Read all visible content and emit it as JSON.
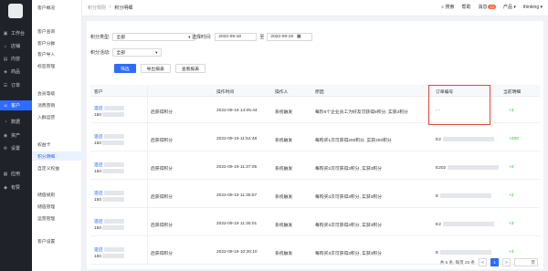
{
  "nav": {
    "items": [
      {
        "label": "工作台",
        "icon": "dashboard-icon"
      },
      {
        "label": "店铺",
        "icon": "store-icon"
      },
      {
        "label": "内容",
        "icon": "content-icon"
      },
      {
        "label": "商品",
        "icon": "goods-icon"
      },
      {
        "label": "订单",
        "icon": "order-icon"
      },
      {
        "label": "客户",
        "icon": "customer-icon"
      },
      {
        "label": "数据",
        "icon": "data-icon"
      },
      {
        "label": "资产",
        "icon": "asset-icon"
      },
      {
        "label": "设置",
        "icon": "settings-icon"
      },
      {
        "label": "应用",
        "icon": "apps-icon"
      },
      {
        "label": "有赞",
        "icon": "youzan-icon"
      }
    ],
    "active_index": 5
  },
  "subnav": {
    "items": [
      "客户概况",
      "客户查询",
      "客户分群",
      "客户导入",
      "标签管理",
      "会员等级",
      "消费营销",
      "入群运营",
      "权益卡",
      "积分明细",
      "自定义权益",
      "储值规则",
      "储值管理",
      "运营管理",
      "客户设置"
    ],
    "active_label": "积分明细"
  },
  "topbar": {
    "breadcrumb": [
      "积分规则",
      "积分明细"
    ],
    "search": "搜索",
    "help": "帮助",
    "message": "消息",
    "message_count": "12",
    "product": "产品",
    "user": "thinking"
  },
  "filters": {
    "type_label": "积分类型:",
    "type_value": "全部",
    "time_label": "选择时间:",
    "date_from": "2022-09-18",
    "date_to_label": "至",
    "date_to": "2022-09-19",
    "activity_label": "积分活动:",
    "activity_value": "全部",
    "btn_filter": "筛选",
    "btn_export": "导出报表",
    "btn_view": "查看报表"
  },
  "table": {
    "headers": {
      "customer": "客户",
      "time": "操作时间",
      "operator": "操作人",
      "reason": "原因",
      "order_no": "订单编号",
      "change": "当前明细"
    },
    "rows": [
      {
        "name": "遗迹",
        "phone": "150",
        "desc": "后获得积分",
        "time": "2022-09-19 14:05:44",
        "operator": "系统触发",
        "reason": "每阶6个企业员工为好友可获得8积分, 实获3积分",
        "order": "- -",
        "change": "+3",
        "change_green": false
      },
      {
        "name": "遗迹",
        "phone": "150",
        "desc": "后获得积分",
        "time": "2022-09-19 11:54:48",
        "operator": "系统触发",
        "reason": "每购买1次可获得200积分, 实获200积分",
        "order": "E2",
        "change": "+200",
        "change_green": true
      },
      {
        "name": "遗迹",
        "phone": "150",
        "desc": "后获得积分",
        "time": "2022-09-19 11:37:05",
        "operator": "系统触发",
        "reason": "每购买2次可获得3积分, 实获3积分",
        "order": "E202",
        "change": "+2",
        "change_green": false
      },
      {
        "name": "遗迹",
        "phone": "150",
        "desc": "后获得积分",
        "time": "2022-09-19 11:35:57",
        "operator": "系统触发",
        "reason": "每购买3次可获得3积分, 实获3积分",
        "order": "E",
        "change": "+2",
        "change_green": false
      },
      {
        "name": "遗迹",
        "phone": "150",
        "desc": "后获得积分",
        "time": "2022-09-19 11:35:01",
        "operator": "系统触发",
        "reason": "每购买3次可获得3积分, 实获3积分",
        "order": "E2",
        "change": "+3",
        "change_green": false
      },
      {
        "name": "遗迹",
        "phone": "150",
        "desc": "后获得积分",
        "time": "2022-09-19 10:30:10",
        "operator": "系统触发",
        "reason": "每购买3次可获得3积分, 实获3积分",
        "order": "E",
        "change": "+3",
        "change_green": false
      }
    ]
  },
  "pager": {
    "summary": "共 6 条, 每页 20 条",
    "prev": "<",
    "current": "1",
    "next": ">",
    "jump_suffix": "页"
  }
}
